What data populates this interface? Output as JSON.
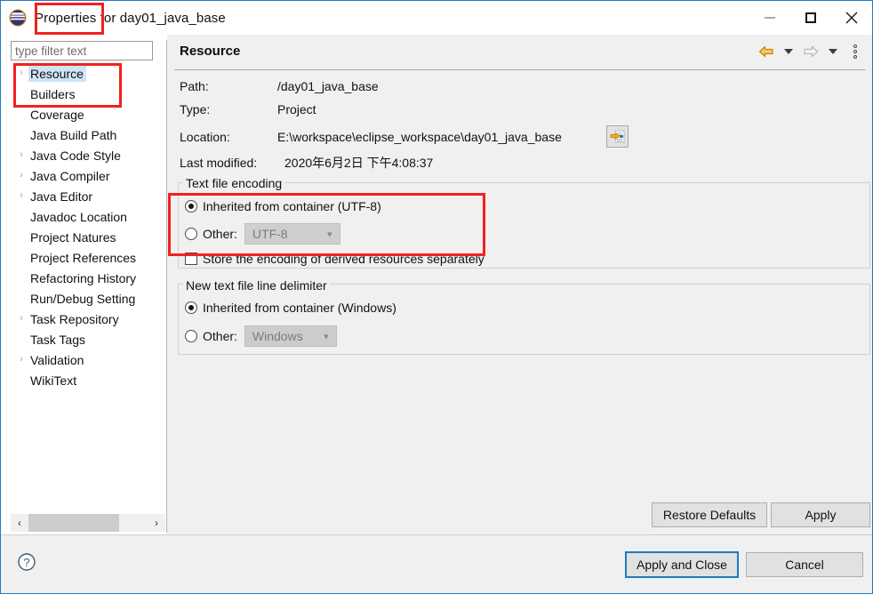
{
  "window": {
    "title": "Properties for day01_java_base",
    "title_highlight": "Properties",
    "app_icon": "eclipse-logo-icon",
    "controls": {
      "minimize": "minimize-icon",
      "maximize": "maximize-icon",
      "close": "close-icon",
      "close_glyph": "✕"
    }
  },
  "sidebar": {
    "filter": {
      "placeholder": "type filter text",
      "value": ""
    },
    "items": [
      {
        "label": "Resource",
        "expandable": true,
        "selected": true
      },
      {
        "label": "Builders",
        "expandable": false,
        "selected": false
      },
      {
        "label": "Coverage",
        "expandable": false,
        "selected": false
      },
      {
        "label": "Java Build Path",
        "expandable": false,
        "selected": false
      },
      {
        "label": "Java Code Style",
        "expandable": true,
        "selected": false
      },
      {
        "label": "Java Compiler",
        "expandable": true,
        "selected": false
      },
      {
        "label": "Java Editor",
        "expandable": true,
        "selected": false
      },
      {
        "label": "Javadoc Location",
        "expandable": false,
        "selected": false
      },
      {
        "label": "Project Natures",
        "expandable": false,
        "selected": false
      },
      {
        "label": "Project References",
        "expandable": false,
        "selected": false
      },
      {
        "label": "Refactoring History",
        "expandable": false,
        "selected": false
      },
      {
        "label": "Run/Debug Setting",
        "expandable": false,
        "selected": false
      },
      {
        "label": "Task Repository",
        "expandable": true,
        "selected": false
      },
      {
        "label": "Task Tags",
        "expandable": false,
        "selected": false
      },
      {
        "label": "Validation",
        "expandable": true,
        "selected": false
      },
      {
        "label": "WikiText",
        "expandable": false,
        "selected": false
      }
    ],
    "expand_glyph": "›",
    "scrollbar": {
      "left_arrow": "‹",
      "right_arrow": "›"
    }
  },
  "main": {
    "page_title": "Resource",
    "nav": {
      "back_icon": "back-arrow-icon",
      "back_dropdown_icon": "chevron-down-icon",
      "forward_icon": "forward-arrow-icon",
      "forward_dropdown_icon": "chevron-down-icon",
      "menu_icon": "view-menu-icon"
    },
    "fields": [
      {
        "label": "Path:",
        "mnemonic": "P",
        "value": "/day01_java_base"
      },
      {
        "label": "Type:",
        "mnemonic": "y",
        "value": "Project"
      },
      {
        "label": "Location:",
        "mnemonic": "L",
        "value": "E:\\workspace\\eclipse_workspace\\day01_java_base"
      },
      {
        "label": "Last modified:",
        "mnemonic": "m",
        "value": "2020年6月2日 下午4:08:37"
      }
    ],
    "location_button_icon": "show-in-system-explorer-icon",
    "encoding_group": {
      "legend": "Text file encoding",
      "inherited_label": "Inherited from container (UTF-8)",
      "inherited_selected": true,
      "other_label": "Other:",
      "other_selected": false,
      "other_value": "UTF-8",
      "store_derived_label": "Store the encoding of derived resources separately",
      "store_derived_checked": false
    },
    "delimiter_group": {
      "legend": "New text file line delimiter",
      "inherited_label": "Inherited from container (Windows)",
      "inherited_selected": true,
      "other_label": "Other:",
      "other_selected": false,
      "other_value": "Windows"
    },
    "buttons": {
      "restore_defaults": "Restore Defaults",
      "apply": "Apply"
    }
  },
  "footer": {
    "help_icon": "help-question-icon",
    "apply_and_close": "Apply and Close",
    "cancel": "Cancel"
  },
  "annotations": {
    "color": "#f42020",
    "boxes": [
      {
        "name": "title-properties-highlight"
      },
      {
        "name": "tree-resource-highlight"
      },
      {
        "name": "encoding-radios-highlight"
      }
    ]
  },
  "colors": {
    "window_border": "#1e7bc4",
    "dialog_bg": "#f0f0f0",
    "selection_blue": "#cfe4f7",
    "focus_blue": "#1e7bc4",
    "annotation_red": "#f42020"
  }
}
